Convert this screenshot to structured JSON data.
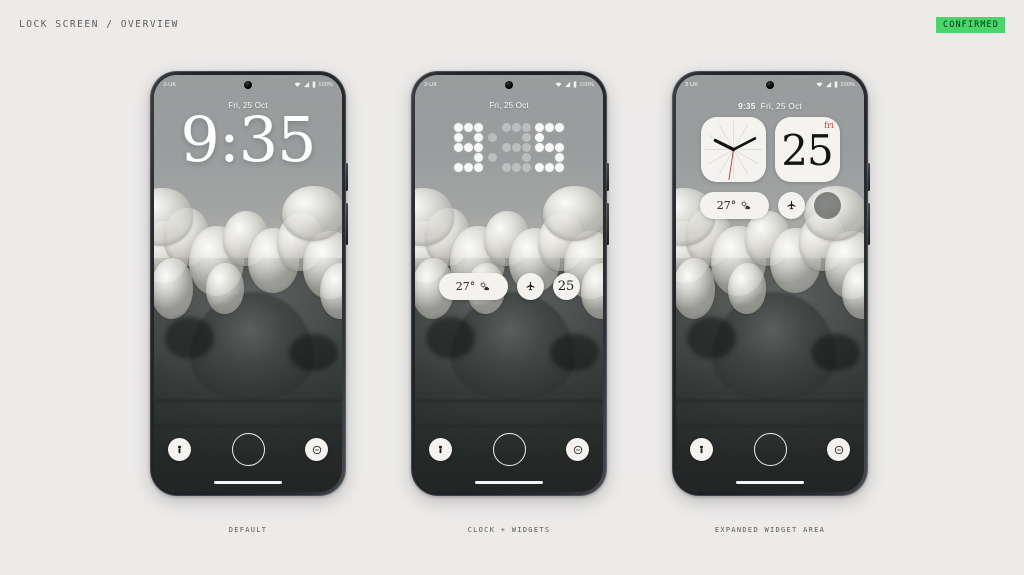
{
  "header": {
    "breadcrumb": "LOCK SCREEN / OVERVIEW",
    "status_badge": "CONFIRMED",
    "badge_color": "#4ad56b"
  },
  "statusbar": {
    "carrier": "3-UK",
    "battery_percent": "100%",
    "icons": [
      "wifi-icon",
      "signal-icon",
      "battery-icon"
    ]
  },
  "phones": [
    {
      "caption": "DEFAULT",
      "date": "Fri, 25 Oct",
      "clock": "9:35",
      "clock_style": "serif-large"
    },
    {
      "caption": "CLOCK + WIDGETS",
      "date": "Fri, 25 Oct",
      "clock": "9:35",
      "clock_style": "dot-matrix",
      "widgets": [
        {
          "type": "weather",
          "temp": "27°",
          "icon": "sun-cloud-icon"
        },
        {
          "type": "airplane",
          "icon": "airplane-icon"
        },
        {
          "type": "calendar",
          "day": "25"
        }
      ]
    },
    {
      "caption": "EXPANDED WIDGET AREA",
      "date": "Fri, 25 Oct",
      "clock": "9:35",
      "clock_style": "header-inline",
      "square_widgets": [
        {
          "type": "analog-clock",
          "icon": "analog-clock-icon"
        },
        {
          "type": "calendar",
          "dow": "fri",
          "day": "25"
        }
      ],
      "widgets": [
        {
          "type": "weather",
          "temp": "27°",
          "icon": "sun-cloud-icon"
        },
        {
          "type": "airplane",
          "icon": "airplane-icon"
        },
        {
          "type": "placeholder",
          "icon": "dark-circle-icon"
        }
      ]
    }
  ],
  "controls": {
    "left": "flashlight-icon",
    "center": "unlock-ring",
    "right": "dnd-icon"
  }
}
